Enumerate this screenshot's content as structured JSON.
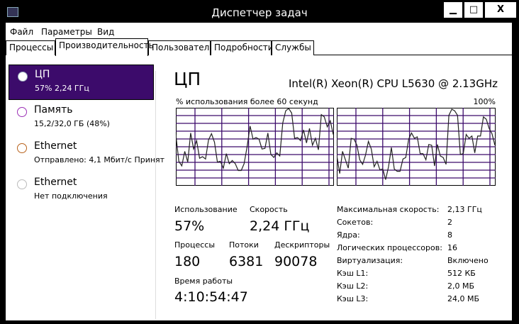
{
  "window": {
    "title": "Диспетчер задач",
    "minimize": "▁",
    "maximize": "□",
    "close": "X"
  },
  "menu": [
    "Файл",
    "Параметры",
    "Вид"
  ],
  "tabs": [
    "Процессы",
    "Производительность",
    "Пользователи",
    "Подробности",
    "Службы"
  ],
  "sidebar": [
    {
      "name": "ЦП",
      "sub": "57% 2,24 ГГц",
      "color": "#ffffff"
    },
    {
      "name": "Память",
      "sub": "15,2/32,0 ГБ (48%)",
      "color": "#9b2fb5"
    },
    {
      "name": "Ethernet",
      "sub": "Отправлено: 4,1 Мбит/с Принят",
      "color": "#b8621b"
    },
    {
      "name": "Ethernet",
      "sub": "Нет подключения",
      "color": "#bbbbbb"
    }
  ],
  "main": {
    "title": "ЦП",
    "cpu_name": "Intel(R) Xeon(R) CPU L5630 @ 2.13GHz",
    "graph_label": "% использования более 60 секунд",
    "graph_max": "100%",
    "stats": {
      "usage_label": "Использование",
      "usage": "57%",
      "speed_label": "Скорость",
      "speed": "2,24 ГГц",
      "proc_label": "Процессы",
      "proc": "180",
      "threads_label": "Потоки",
      "threads": "6381",
      "handles_label": "Дескрипторы",
      "handles": "90078",
      "uptime_label": "Время работы",
      "uptime": "4:10:54:47"
    },
    "specs": [
      {
        "k": "Максимальная скорость:",
        "v": "2,13 ГГц"
      },
      {
        "k": "Сокетов:",
        "v": "2"
      },
      {
        "k": "Ядра:",
        "v": "8"
      },
      {
        "k": "Логических процессоров:",
        "v": "16"
      },
      {
        "k": "Виртуализация:",
        "v": "Включено"
      },
      {
        "k": "Кэш L1:",
        "v": "512 КБ"
      },
      {
        "k": "Кэш L2:",
        "v": "2,0 МБ"
      },
      {
        "k": "Кэш L3:",
        "v": "24,0 МБ"
      }
    ]
  },
  "chart_data": {
    "type": "line",
    "ylim": [
      0,
      100
    ],
    "grid_color": "#3c0b6b",
    "series": [
      {
        "name": "cpu-graph-1",
        "values": [
          66,
          31,
          25,
          44,
          30,
          68,
          47,
          58,
          35,
          37,
          34,
          59,
          67,
          56,
          30,
          31,
          22,
          41,
          28,
          32,
          28,
          19,
          19,
          28,
          50,
          77,
          60,
          62,
          60,
          47,
          48,
          68,
          40,
          36,
          42,
          38,
          81,
          97,
          100,
          94,
          61,
          62,
          58,
          72,
          55,
          74,
          52,
          61,
          46,
          92,
          89,
          76,
          84,
          66
        ]
      },
      {
        "name": "cpu-graph-2",
        "values": [
          39,
          15,
          44,
          33,
          22,
          61,
          60,
          52,
          33,
          27,
          39,
          57,
          47,
          24,
          31,
          20,
          21,
          7,
          24,
          49,
          21,
          18,
          18,
          34,
          36,
          60,
          68,
          61,
          63,
          41,
          41,
          33,
          53,
          52,
          25,
          53,
          38,
          36,
          27,
          91,
          99,
          97,
          91,
          40,
          41,
          66,
          61,
          64,
          42,
          64,
          64,
          89,
          86,
          74,
          67,
          52
        ]
      }
    ]
  }
}
